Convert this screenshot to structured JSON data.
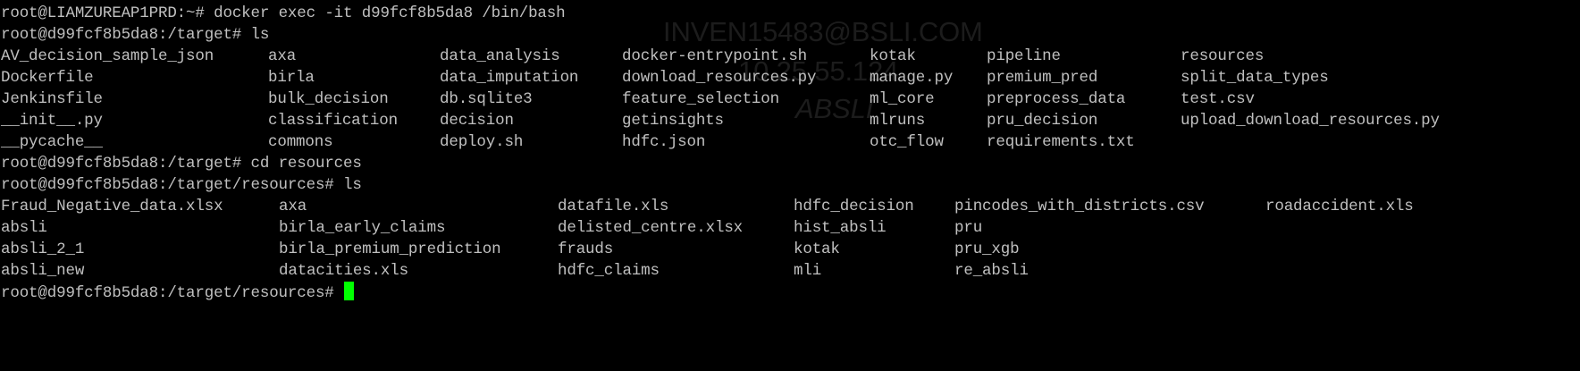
{
  "colors": {
    "background": "#000000",
    "text": "#c0c0c0",
    "cursor": "#00ff00",
    "watermark": "#1c1c1c"
  },
  "watermark": {
    "line1": "INVEN15483@BSLI.COM",
    "line2": "10.25.55.124",
    "line3": "ABSLI"
  },
  "session": [
    {
      "type": "prompt",
      "prompt": "root@LIAMZUREAP1PRD:~#",
      "command": "docker exec -it d99fcf8b5da8 /bin/bash"
    },
    {
      "type": "prompt",
      "prompt": "root@d99fcf8b5da8:/target#",
      "command": "ls"
    },
    {
      "type": "row",
      "cells": [
        "AV_decision_sample_json",
        "axa",
        "data_analysis",
        "docker-entrypoint.sh",
        "kotak",
        "pipeline",
        "resources"
      ]
    },
    {
      "type": "row",
      "cells": [
        "Dockerfile",
        "birla",
        "data_imputation",
        "download_resources.py",
        "manage.py",
        "premium_pred",
        "split_data_types"
      ]
    },
    {
      "type": "row",
      "cells": [
        "Jenkinsfile",
        "bulk_decision",
        "db.sqlite3",
        "feature_selection",
        "ml_core",
        "preprocess_data",
        "test.csv"
      ]
    },
    {
      "type": "row",
      "cells": [
        "__init__.py",
        "classification",
        "decision",
        "getinsights",
        "mlruns",
        "pru_decision",
        "upload_download_resources.py"
      ]
    },
    {
      "type": "row",
      "cells": [
        "__pycache__",
        "commons",
        "deploy.sh",
        "hdfc.json",
        "otc_flow",
        "requirements.txt",
        ""
      ]
    },
    {
      "type": "prompt",
      "prompt": "root@d99fcf8b5da8:/target#",
      "command": "cd resources"
    },
    {
      "type": "prompt",
      "prompt": "root@d99fcf8b5da8:/target/resources#",
      "command": "ls"
    },
    {
      "type": "row",
      "cells": [
        "Fraud_Negative_data.xlsx",
        "axa",
        "datafile.xls",
        "hdfc_decision",
        "pincodes_with_districts.csv",
        "roadaccident.xls"
      ]
    },
    {
      "type": "row",
      "cells": [
        "absli",
        "birla_early_claims",
        "delisted_centre.xlsx",
        "hist_absli",
        "pru",
        ""
      ]
    },
    {
      "type": "row",
      "cells": [
        "absli_2_1",
        "birla_premium_prediction",
        "frauds",
        "kotak",
        "pru_xgb",
        ""
      ]
    },
    {
      "type": "row",
      "cells": [
        "absli_new",
        "datacities.xls",
        "hdfc_claims",
        "mli",
        "re_absli",
        ""
      ]
    },
    {
      "type": "prompt",
      "prompt": "root@d99fcf8b5da8:/target/resources#",
      "command": "",
      "active": true
    }
  ]
}
